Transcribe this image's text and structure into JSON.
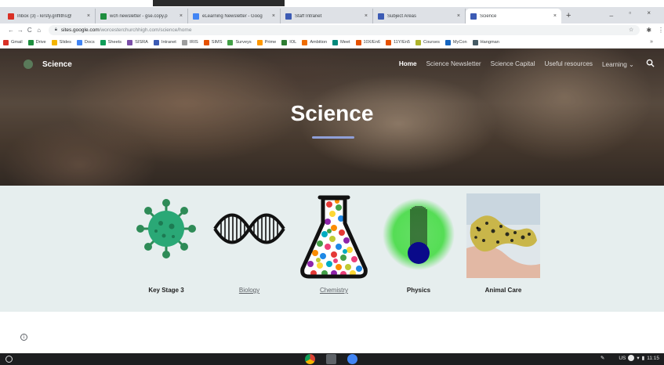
{
  "browser": {
    "tabs": [
      {
        "title": "Inbox (3) - kirsty.griffiths@",
        "color": "#d93025"
      },
      {
        "title": "wch newsletter - gse.copy.p",
        "color": "#1e8e3e"
      },
      {
        "title": "eLearning Newsletter - Goog",
        "color": "#4285f4"
      },
      {
        "title": "Staff Intranet",
        "color": "#3c5bb4"
      },
      {
        "title": "Subject Areas",
        "color": "#3c5bb4"
      },
      {
        "title": "Science",
        "color": "#3c5bb4",
        "active": true
      }
    ],
    "close_glyph": "×",
    "new_tab_glyph": "+",
    "window_controls": "_ ▫ ×",
    "url_domain": "sites.google.com",
    "url_path": "/worcesterchurchhigh.com/science/home",
    "nav": {
      "back": "←",
      "forward": "→",
      "reload": "C",
      "home": "⌂"
    },
    "bookmarks": [
      {
        "label": "Gmail",
        "color": "#d93025"
      },
      {
        "label": "Drive",
        "color": "#1e8e3e"
      },
      {
        "label": "Slides",
        "color": "#f4b400"
      },
      {
        "label": "Docs",
        "color": "#4285f4"
      },
      {
        "label": "Sheets",
        "color": "#0f9d58"
      },
      {
        "label": "SISRA",
        "color": "#7b4fa8"
      },
      {
        "label": "Intranet",
        "color": "#3c5bb4"
      },
      {
        "label": "IRIS",
        "color": "#9e9e9e"
      },
      {
        "label": "SIMS",
        "color": "#e65100"
      },
      {
        "label": "Surveys",
        "color": "#43a047"
      },
      {
        "label": "Prime",
        "color": "#ff9800"
      },
      {
        "label": "IOL",
        "color": "#2e7d32"
      },
      {
        "label": "Ambition",
        "color": "#ef6c00"
      },
      {
        "label": "Meet",
        "color": "#00897b"
      },
      {
        "label": "10X/En6",
        "color": "#e65100"
      },
      {
        "label": "11Y/En5",
        "color": "#e65100"
      },
      {
        "label": "Courses",
        "color": "#afb42b"
      },
      {
        "label": "MyCon",
        "color": "#1565c0"
      },
      {
        "label": "Hangman",
        "color": "#455a64"
      }
    ],
    "bookmarks_more": "»"
  },
  "site": {
    "name": "Science",
    "nav": [
      "Home",
      "Science Newsletter",
      "Science Capital",
      "Useful resources",
      "Learning ⌄"
    ],
    "hero_title": "Science",
    "accent": "#8f9fd8"
  },
  "subjects": [
    {
      "label": "Key Stage 3",
      "link": false
    },
    {
      "label": "Biology",
      "link": true
    },
    {
      "label": "Chemistry",
      "link": true
    },
    {
      "label": "Physics",
      "link": false
    },
    {
      "label": "Animal Care",
      "link": false
    }
  ],
  "info_glyph": "i",
  "taskbar": {
    "tray": "US",
    "clock": "11:15"
  }
}
